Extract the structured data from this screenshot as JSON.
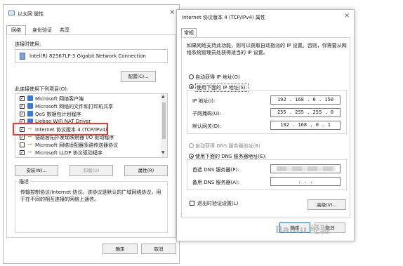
{
  "left_dialog": {
    "title": "以太网 属性",
    "tabs": [
      "网络",
      "身份验证",
      "共享"
    ],
    "connect_using_label": "连接时使用:",
    "adapter_name": "Intel(R) 82567LF-3 Gigabit Network Connection",
    "configure_button": "配置(C)...",
    "items_label": "此连接使用下列项目(O):",
    "items": [
      {
        "label": "Microsoft 网络客户端",
        "checked": true
      },
      {
        "label": "Microsoft 网络的文件和打印机共享",
        "checked": true
      },
      {
        "label": "QoS 数据包计划程序",
        "checked": true
      },
      {
        "label": "Liebao WiFi NAT Driver",
        "checked": true
      },
      {
        "label": "Internet 协议版本 4 (TCP/IPv4)",
        "checked": true
      },
      {
        "label": "链路层拓扑发现映射器 I/O 驱动程序",
        "checked": true
      },
      {
        "label": "Microsoft 网络适配器多路传送器协议",
        "checked": false
      },
      {
        "label": "Microsoft LLDP 协议驱动程序",
        "checked": true
      }
    ],
    "install_button": "安装(N)...",
    "uninstall_button": "卸载(U)",
    "properties_button": "属性(R)",
    "description_label": "描述",
    "description_text": "传输控制协议/Internet 协议。该协议是默认的广域网络协议，用于在不同的相互连接的网络上通信。",
    "ok_button": "确定",
    "cancel_button": "取消"
  },
  "right_dialog": {
    "title": "Internet 协议版本 4 (TCP/IPv4) 属性",
    "tab": "常规",
    "intro_text": "如果网络支持此功能，则可以获取自动指派的 IP 设置。否则，你需要从网络系统管理员处获得适当的 IP 设置。",
    "auto_ip_label": "自动获得 IP 地址(O)",
    "manual_ip_label": "使用下面的 IP 地址(S):",
    "ip_address_label": "IP 地址(I):",
    "ip_address_value": "192 . 168 . 0 . 150",
    "subnet_label": "子网掩码(U):",
    "subnet_value": "255 . 255 . 255 . 0",
    "gateway_label": "默认网关(D):",
    "gateway_value": "192 . 168 . 0 . 1",
    "auto_dns_label": "自动获得 DNS 服务器地址(B)",
    "manual_dns_label": "使用下面的 DNS 服务器地址(E):",
    "preferred_dns_label": "首选 DNS 服务器(P):",
    "alternate_dns_label": "备用 DNS 服务器(A):",
    "alternate_dns_value": ".      .      .",
    "validate_label": "退出时验证设置(L)",
    "advanced_button": "高级(V)...",
    "ok_button": "确定",
    "cancel_button": "取消"
  },
  "colors": {
    "highlight_red": "#e53935",
    "focus_blue": "#0078d7",
    "dialog_border": "#b9b9b9"
  },
  "watermark": "Baidu 经验"
}
